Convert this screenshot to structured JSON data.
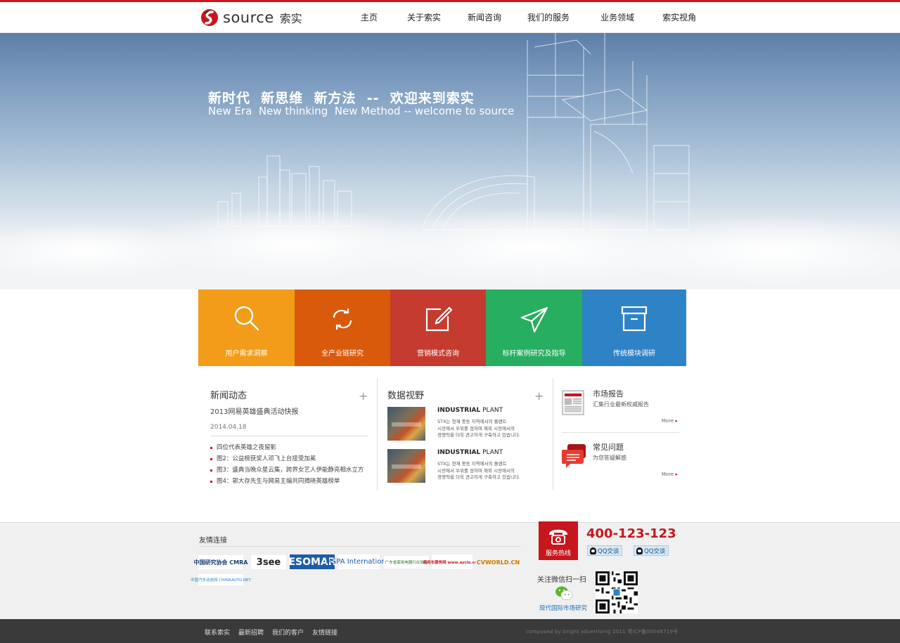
{
  "brand": {
    "logo_text": "source",
    "logo_cn": "索实",
    "accent_color": "#c8161d"
  },
  "nav": {
    "items": [
      "主页",
      "关于索实",
      "新闻咨询",
      "我们的服务",
      "业务领域",
      "索实视角"
    ]
  },
  "hero": {
    "title_cn": "新时代  新思维  新方法  --  欢迎来到索实",
    "title_en": "New Era  New thinking  New Method -- welcome to source"
  },
  "tiles": [
    {
      "label": "用户需求洞察",
      "icon": "search-icon",
      "color": "#f29c1a"
    },
    {
      "label": "全产业链研究",
      "icon": "refresh-icon",
      "color": "#d95a0b"
    },
    {
      "label": "营销模式咨询",
      "icon": "edit-icon",
      "color": "#c63b2f"
    },
    {
      "label": "标杆案例研究及指导",
      "icon": "send-icon",
      "color": "#27ae60"
    },
    {
      "label": "传统模块调研",
      "icon": "archive-icon",
      "color": "#2e82c6"
    }
  ],
  "news": {
    "title": "新闻动态",
    "plus": "+",
    "headline": "2013网易英雄盛典活动快报",
    "date": "2014.04.18",
    "items": [
      "四位代表英雄之夜留影",
      "图2：公益榜获奖人邓飞上台接受加冕",
      "图3：盛典当晚众星云集，跨界女艺人伊能静亮相水立方",
      "图4：郭大存先生与网易主编共同揭晓英雄榜单"
    ]
  },
  "data_view": {
    "title": "数据视野",
    "plus": "+",
    "items": [
      {
        "title_bold": "INDUSTRIAL",
        "title_rest": " PLANT",
        "body": "STX는 현재 중동 지역에서의 플랜트\n시장에서 우위를 점하며 해외 시장에서의\n경쟁력을 더욱 견고하게 구축하고 있습니다."
      },
      {
        "title_bold": "INDUSTRIAL",
        "title_rest": " PLANT",
        "body": "STX는 현재 중동 지역에서의 플랜트\n시장에서 우위를 점하며 해외 시장에서의\n경쟁력을 더욱 견고하게 구축하고 있습니다."
      }
    ]
  },
  "side": {
    "items": [
      {
        "title": "市场报告",
        "subtitle": "汇集行业最新权威报告",
        "more": "More"
      },
      {
        "title": "常见问题",
        "subtitle": "为您答疑解惑",
        "more": "More"
      }
    ]
  },
  "footer": {
    "links_title": "友情连接",
    "partners": [
      "中国研究协会 CMRA",
      "3see",
      "ESOMAR",
      "MSPA International",
      "广东省家用电器行业协会",
      "商用车服务网 www.ayclo.com",
      "CVWORLD.CN",
      "中国汽车动态网 CHINAAUTO.NET"
    ],
    "hotline_label": "服务热线",
    "phone": "400-123-123",
    "qq_label": "QQ交谈",
    "wechat_title": "关注微信扫一扫",
    "wechat_name": "现代国际市场研究",
    "bottom_links": [
      "联系索实",
      "最新招聘",
      "我们的客户",
      "友情链接"
    ],
    "copyright": "composed by bright advertising  2011 粤ICP备05048719号"
  }
}
